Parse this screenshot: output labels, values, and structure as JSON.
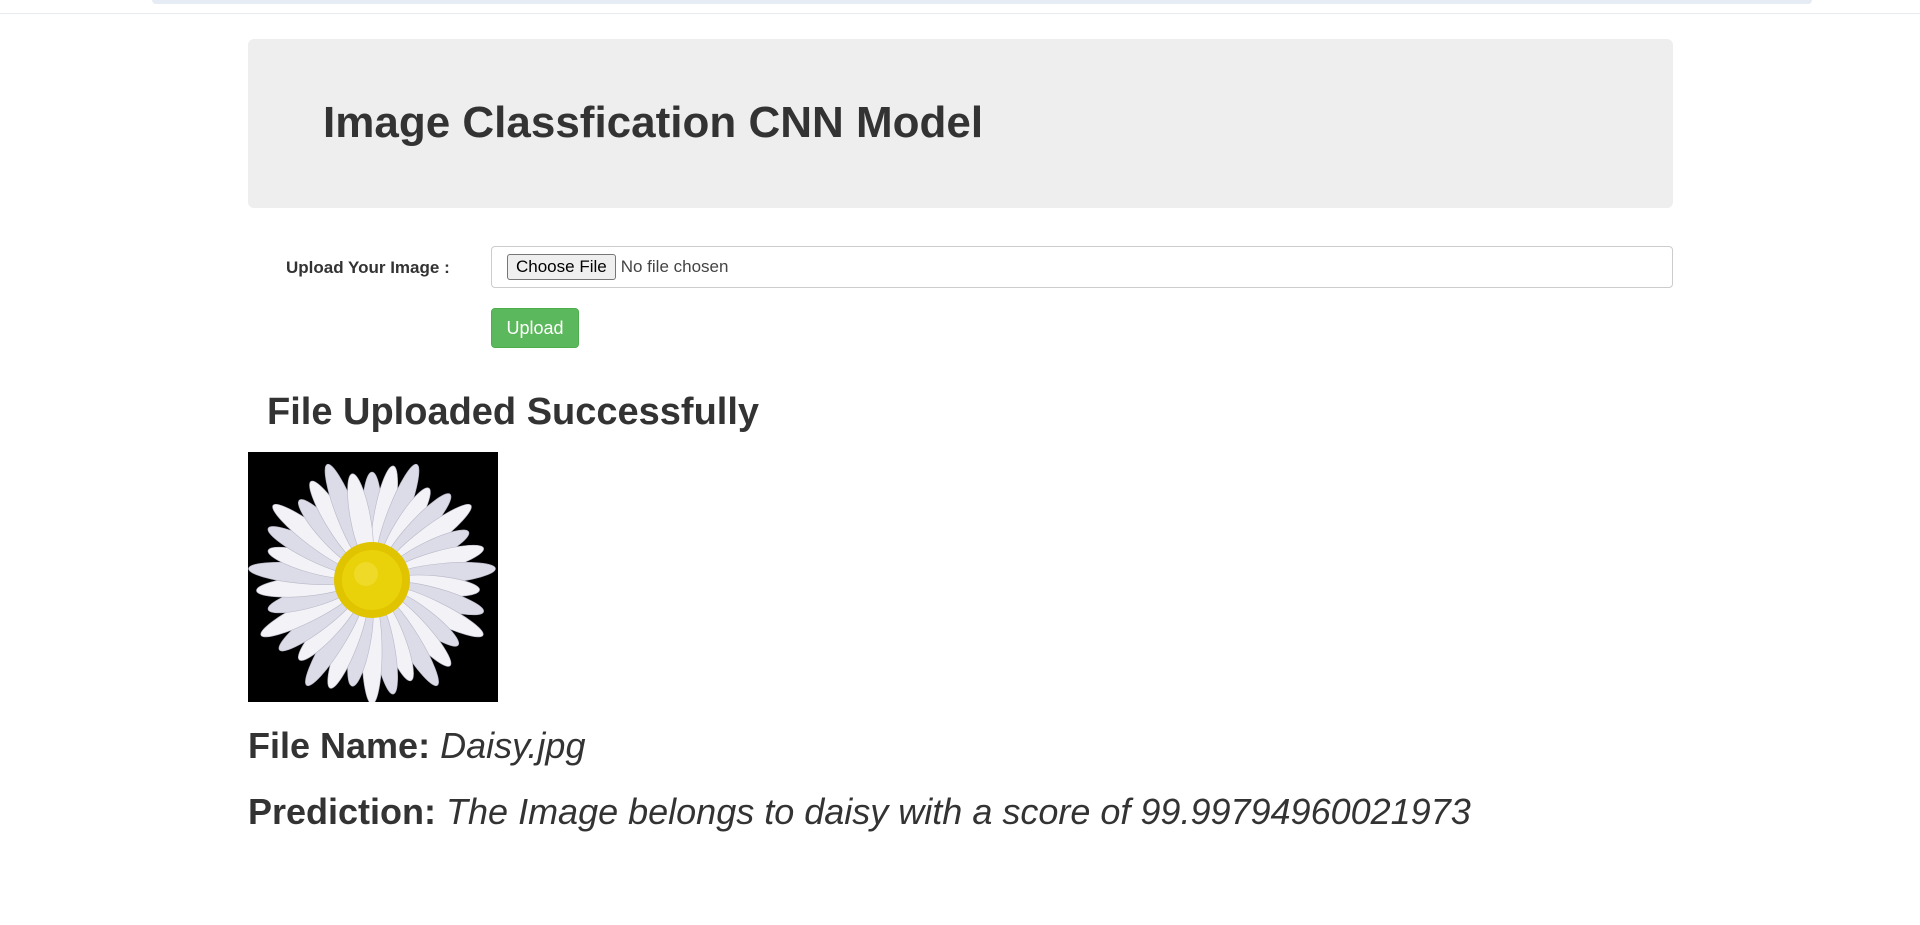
{
  "header": {
    "title": "Image Classfication CNN Model"
  },
  "form": {
    "label": "Upload Your Image :",
    "choose_file_label": "Choose File",
    "no_file_text": "No file chosen",
    "upload_label": "Upload"
  },
  "result": {
    "status": "File Uploaded Successfully",
    "file_name_label": "File Name:",
    "file_name_value": "Daisy.jpg",
    "prediction_label": "Prediction:",
    "prediction_value": "The Image belongs to daisy with a score of 99.99794960021973",
    "image_subject": "daisy-flower"
  },
  "colors": {
    "upload_button": "#5cb85c",
    "jumbotron_bg": "#eeeeee",
    "text": "#333333"
  }
}
